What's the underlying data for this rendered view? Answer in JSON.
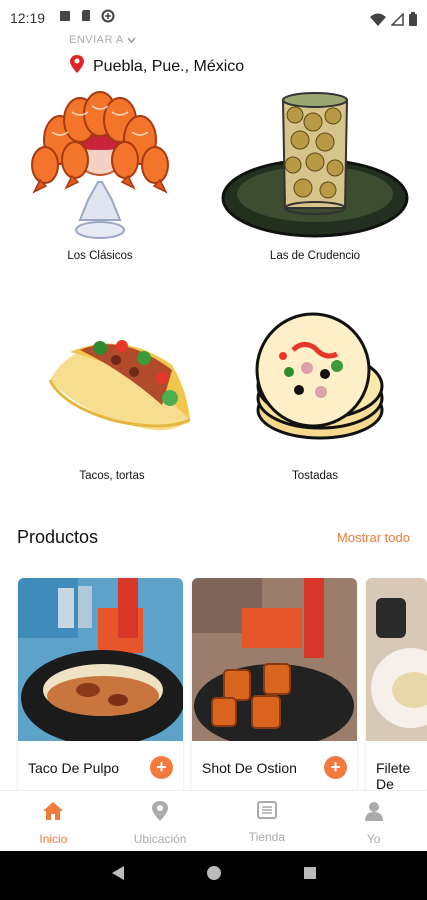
{
  "status_bar": {
    "time": "12:19"
  },
  "header": {
    "deliver_label": "ENVIAR A",
    "location": "Puebla, Pue., México"
  },
  "categories": [
    {
      "label": "Los Clásicos",
      "icon": "shrimp-cocktail-icon"
    },
    {
      "label": "Las de Crudencio",
      "icon": "oyster-glass-icon"
    },
    {
      "label": "Tacos, tortas",
      "icon": "taco-icon"
    },
    {
      "label": "Tostadas",
      "icon": "tostada-icon"
    }
  ],
  "products_section": {
    "title": "Productos",
    "show_all": "Mostrar todo"
  },
  "products": [
    {
      "name": "Taco De Pulpo"
    },
    {
      "name": "Shot De Ostion"
    },
    {
      "name": "Filete De Pescado"
    }
  ],
  "bottom_nav": [
    {
      "label": "Inicio",
      "icon": "home-icon",
      "active": true
    },
    {
      "label": "Ubicación",
      "icon": "location-pin-icon",
      "active": false
    },
    {
      "label": "Tienda",
      "icon": "store-list-icon",
      "active": false
    },
    {
      "label": "Yo",
      "icon": "user-icon",
      "active": false
    }
  ],
  "colors": {
    "accent": "#f07a3e",
    "inactive": "#aaaaaa"
  }
}
